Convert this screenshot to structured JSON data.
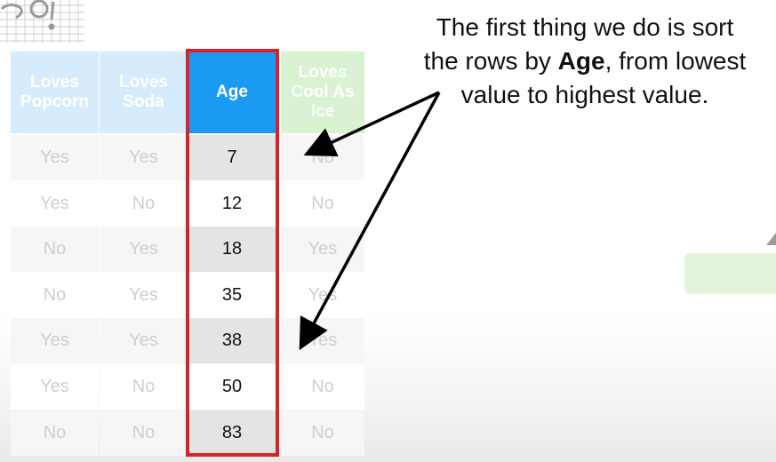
{
  "callout": {
    "line1": "The first thing we do is sort",
    "line2_pre": "the rows by ",
    "line2_bold": "Age",
    "line2_post": ", from lowest",
    "line3": "value to highest value."
  },
  "table": {
    "headers": [
      {
        "l1": "Loves",
        "l2": "Popcorn",
        "l3": ""
      },
      {
        "l1": "Loves",
        "l2": "Soda",
        "l3": ""
      },
      {
        "l1": "Age",
        "l2": "",
        "l3": ""
      },
      {
        "l1": "Loves",
        "l2": "Cool As",
        "l3": "Ice"
      }
    ],
    "rows": [
      [
        "Yes",
        "Yes",
        "7",
        "No"
      ],
      [
        "Yes",
        "No",
        "12",
        "No"
      ],
      [
        "No",
        "Yes",
        "18",
        "Yes"
      ],
      [
        "No",
        "Yes",
        "35",
        "Yes"
      ],
      [
        "Yes",
        "Yes",
        "38",
        "Yes"
      ],
      [
        "Yes",
        "No",
        "50",
        "No"
      ],
      [
        "No",
        "No",
        "83",
        "No"
      ]
    ]
  },
  "colors": {
    "highlight": "#d3242a",
    "age_header": "#1a9af2",
    "blue_header": "#d6ebfb",
    "green_header": "#d9f2d2",
    "arrow": "#000000"
  }
}
